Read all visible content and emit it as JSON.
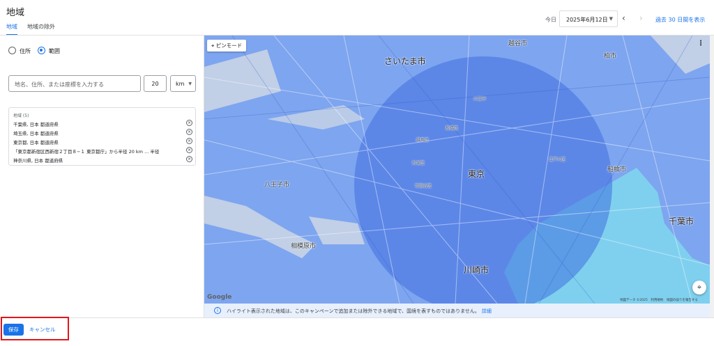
{
  "header": {
    "title": "地域",
    "tabs": [
      {
        "label": "地域",
        "active": true
      },
      {
        "label": "地域の除外",
        "active": false
      }
    ],
    "date_label": "今日",
    "date_value": "2025年6月12日",
    "recent_link": "過去 30 日間を表示"
  },
  "left_panel": {
    "radio_options": [
      {
        "label": "住所",
        "checked": false
      },
      {
        "label": "範囲",
        "checked": true
      }
    ],
    "location_input_placeholder": "地名、住所、または座標を入力する",
    "radius_value": "20",
    "unit_value": "km",
    "regions": {
      "header": "地域 (5)",
      "items": [
        "千葉県, 日本 都道府県",
        "埼玉県, 日本 都道府県",
        "東京都, 日本 都道府県",
        "「東京都新宿区西新宿２丁目８−１ 東京都庁」から半径 20 km ... 半径",
        "神奈川県, 日本 都道府県"
      ]
    }
  },
  "map": {
    "pin_mode_label": "ピンモード",
    "google_logo": "Google",
    "attribution": "地図データ ©2025　利用規約　地図の誤りを報告する",
    "labels": {
      "saitama": "さいたま市",
      "tokyo": "東京",
      "chiba": "千葉市",
      "kawasaki": "川崎市",
      "sagamihara": "相模原市",
      "hachioji": "八王子市",
      "funabashi": "船橋市",
      "kashiwa": "柏市",
      "koshigaya": "越谷市",
      "edogawa": "江戸川区",
      "setagaya": "世田谷区",
      "suginami": "杉並区",
      "nerima": "練馬区",
      "itabashi": "板橋区",
      "kawaguchi": "川口市"
    }
  },
  "info_bar": {
    "text": "ハイライト表示された地域は、このキャンペーンで追加または除外できる地域で、国境を表すものではありません。",
    "link": "詳細"
  },
  "footer": {
    "save_label": "保存",
    "cancel_label": "キャンセル"
  },
  "colors": {
    "accent": "#1a73e8",
    "region_fill": "#5b8ff0",
    "radius_fill": "#4a7de8",
    "water": "#7fd0ee",
    "highlight": "#e0161b"
  },
  "icons": {
    "more": "more-vert-icon",
    "locate": "my-location-icon",
    "info": "info-icon",
    "remove": "cancel-circle-icon",
    "pin": "pin-icon"
  }
}
